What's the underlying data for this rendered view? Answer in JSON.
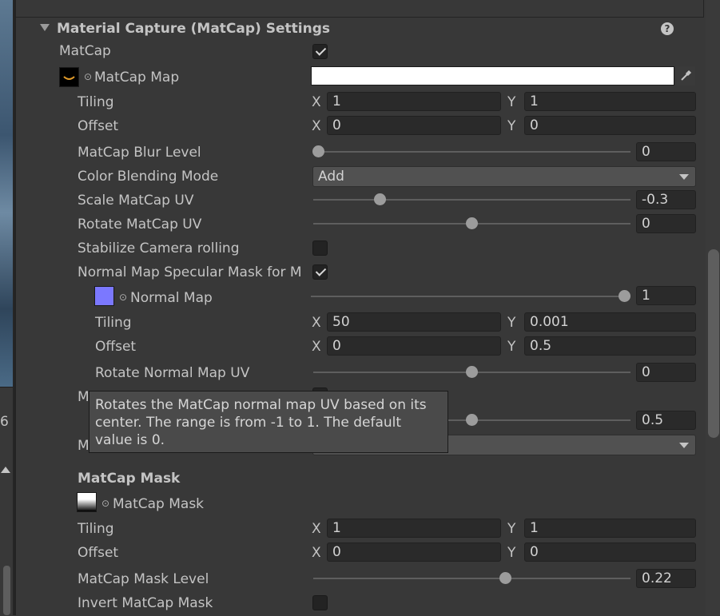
{
  "section": {
    "title": "Material Capture (MatCap) Settings",
    "help_icon": "help-icon"
  },
  "side": {
    "value": "6"
  },
  "matcap": {
    "label": "MatCap",
    "checked": true
  },
  "matcap_map": {
    "label": "MatCap Map",
    "value": "",
    "picker_icon": "eyedropper-icon"
  },
  "tiling1": {
    "label": "Tiling",
    "x_label": "X",
    "x": "1",
    "y_label": "Y",
    "y": "1"
  },
  "offset1": {
    "label": "Offset",
    "x_label": "X",
    "x": "0",
    "y_label": "Y",
    "y": "0"
  },
  "blur": {
    "label": "MatCap Blur Level",
    "value": "0",
    "fraction": 0.0
  },
  "blend": {
    "label": "Color Blending Mode",
    "value": "Add"
  },
  "scale_uv": {
    "label": "Scale MatCap UV",
    "value": "-0.3",
    "fraction": 0.21
  },
  "rotate_uv": {
    "label": "Rotate MatCap UV",
    "value": "0",
    "fraction": 0.5
  },
  "stabilize": {
    "label": "Stabilize Camera rolling",
    "checked": false
  },
  "normal_spec": {
    "label": "Normal Map Specular Mask for M",
    "checked": true
  },
  "normal_map": {
    "label": "Normal Map",
    "value": "1",
    "fraction": 1.0
  },
  "tiling2": {
    "label": "Tiling",
    "x_label": "X",
    "x": "50",
    "y_label": "Y",
    "y": "0.001"
  },
  "offset2": {
    "label": "Offset",
    "x_label": "X",
    "x": "0",
    "y_label": "Y",
    "y": "0.5"
  },
  "rotate_normal": {
    "label": "Rotate Normal Map UV",
    "value": "0",
    "fraction": 0.5
  },
  "hidden_row1": {
    "label": "M",
    "value": "0.5",
    "fraction": 0.5
  },
  "hidden_row2": {
    "label": "M"
  },
  "tooltip": {
    "text": "Rotates the MatCap normal map UV based on its center. The range is from -1 to 1. The default value is 0."
  },
  "mask_header": {
    "label": "MatCap Mask"
  },
  "mask_tex": {
    "label": "MatCap Mask"
  },
  "tiling3": {
    "label": "Tiling",
    "x_label": "X",
    "x": "1",
    "y_label": "Y",
    "y": "1"
  },
  "offset3": {
    "label": "Offset",
    "x_label": "X",
    "x": "0",
    "y_label": "Y",
    "y": "0"
  },
  "mask_level": {
    "label": "MatCap Mask Level",
    "value": "0.22",
    "fraction": 0.61
  },
  "invert_mask": {
    "label": "Invert MatCap Mask",
    "checked": false
  }
}
